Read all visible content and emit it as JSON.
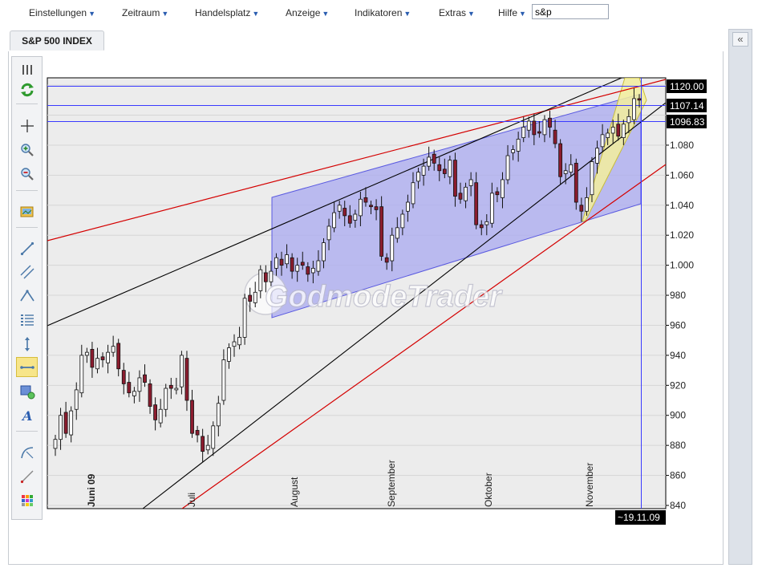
{
  "menu": {
    "items": [
      "Einstellungen",
      "Zeitraum",
      "Handelsplatz",
      "Anzeige",
      "Indikatoren",
      "Extras",
      "Hilfe"
    ],
    "search_value": "s&p"
  },
  "tab": {
    "title": "S&P 500 INDEX"
  },
  "collapse": {
    "label": "«"
  },
  "toolbar": {
    "tools": [
      "grip-icon",
      "refresh-icon",
      "crosshair-icon",
      "zoom-in-icon",
      "zoom-out-icon",
      "image-export-icon",
      "trendline-icon",
      "channel-icon",
      "curve-icon",
      "fibonacci-icon",
      "vertical-line-icon",
      "horizontal-line-icon",
      "rectangle-icon",
      "text-icon",
      "arc-icon",
      "ray-icon",
      "grid-icon"
    ],
    "active_tool": "horizontal-line-icon"
  },
  "chart_data": {
    "type": "candlestick",
    "title": "S&P 500 INDEX",
    "y_ticks": [
      "1.080",
      "1.060",
      "1.040",
      "1.020",
      "1.000",
      "980",
      "960",
      "940",
      "920",
      "900",
      "880",
      "860",
      "840"
    ],
    "ylim": [
      836,
      1125
    ],
    "months": [
      "Juni 09",
      "Juli",
      "August",
      "September",
      "Oktober",
      "November"
    ],
    "horizontal_levels": [
      1120.0,
      1107.14,
      1096.83
    ],
    "level_labels": [
      "1120.00",
      "1107.14",
      "1096.83"
    ],
    "date_marker": "~19.11.09",
    "watermark": "GodmodeTrader",
    "colors": {
      "up": "#ffffff",
      "down": "#8b1c2e",
      "channel_fill": "#aaaaf0",
      "wedge_fill": "#f3ee9c",
      "trend_red": "#d40000",
      "trend_black": "#000000",
      "level_blue": "#3a3aff"
    },
    "closes": [
      884,
      900,
      888,
      903,
      917,
      940,
      942,
      932,
      938,
      937,
      942,
      946,
      931,
      921,
      915,
      916,
      925,
      922,
      906,
      897,
      904,
      918,
      918,
      918,
      940,
      910,
      888,
      887,
      876,
      880,
      893,
      908,
      937,
      945,
      949,
      952,
      978,
      976,
      982,
      997,
      989,
      996,
      1005,
      1000,
      1007,
      996,
      1000,
      1000,
      994,
      998,
      1003,
      1015,
      1026,
      1035,
      1040,
      1033,
      1028,
      1034,
      1044,
      1042,
      1039,
      1037,
      1006,
      1002,
      1020,
      1025,
      1034,
      1042,
      1055,
      1062,
      1066,
      1072,
      1068,
      1063,
      1061,
      1070,
      1046,
      1044,
      1052,
      1057,
      1027,
      1025,
      1029,
      1048,
      1047,
      1057,
      1073,
      1077,
      1084,
      1092,
      1096,
      1087,
      1088,
      1097,
      1092,
      1081,
      1059,
      1063,
      1067,
      1042,
      1036,
      1045,
      1069,
      1078,
      1087,
      1088,
      1092,
      1086,
      1094,
      1099,
      1111,
      1110
    ]
  }
}
